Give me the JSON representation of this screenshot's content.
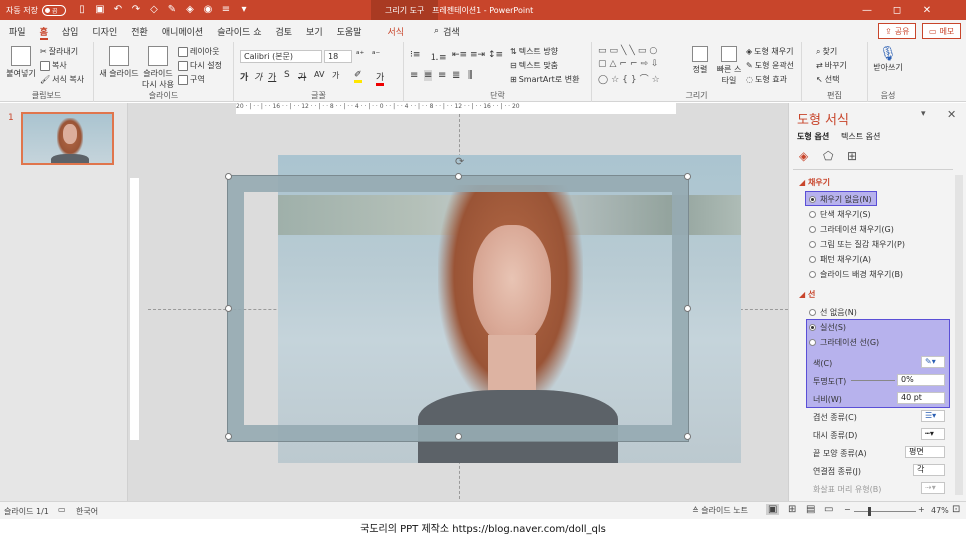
{
  "titlebar": {
    "autosave_label": "자동 저장",
    "autosave_state": "끔",
    "context_tab": "그리기 도구",
    "document_title": "프레젠테이션1 - PowerPoint",
    "win_min": "—",
    "win_restore": "◻",
    "win_close": "✕"
  },
  "menu": {
    "items": [
      "파일",
      "홈",
      "삽입",
      "디자인",
      "전환",
      "애니메이션",
      "슬라이드 쇼",
      "검토",
      "보기",
      "도움말"
    ],
    "context_item": "서식",
    "search": "검색",
    "share": "공유",
    "memo": "메모"
  },
  "ribbon": {
    "clipboard": {
      "paste": "붙여넣기",
      "cut": "잘라내기",
      "copy": "복사",
      "format_painter": "서식 복사",
      "label": "클립보드"
    },
    "slides": {
      "new_slide": "새 슬라이드",
      "reuse": "슬라이드 다시 사용",
      "layout": "레이아웃",
      "reset": "다시 설정",
      "section": "구역",
      "label": "슬라이드"
    },
    "font": {
      "name": "Calibri (본문)",
      "size": "18",
      "label": "글꼴"
    },
    "paragraph": {
      "text_direction": "텍스트 방향",
      "align_text": "텍스트 맞춤",
      "smartart": "SmartArt로 변환",
      "label": "단락"
    },
    "drawing": {
      "arrange": "정렬",
      "quick_styles": "빠른 스타일",
      "fill": "도형 채우기",
      "outline": "도형 윤곽선",
      "effects": "도형 효과",
      "label": "그리기"
    },
    "editing": {
      "find": "찾기",
      "replace": "바꾸기",
      "select": "선택",
      "label": "편집"
    },
    "voice": {
      "dictate": "받아쓰기",
      "label": "음성"
    }
  },
  "slide_panel": {
    "number": "1"
  },
  "pane": {
    "title": "도형 서식",
    "tab_shape": "도형 옵션",
    "tab_text": "텍스트 옵션",
    "fill_section": "채우기",
    "fill_options": [
      "채우기 없음(N)",
      "단색 채우기(S)",
      "그라데이션 채우기(G)",
      "그림 또는 질감 채우기(P)",
      "패턴 채우기(A)",
      "슬라이드 배경 채우기(B)"
    ],
    "line_section": "선",
    "line_options": [
      "선 없음(N)",
      "실선(S)",
      "그라데이션 선(G)"
    ],
    "color_label": "색(C)",
    "transparency_label": "투명도(T)",
    "transparency_value": "0%",
    "width_label": "너비(W)",
    "width_value": "40 pt",
    "compound_label": "겹선 종류(C)",
    "dash_label": "대시 종류(D)",
    "cap_label": "끝 모양 종류(A)",
    "cap_value": "평면",
    "join_label": "연결점 종류(J)",
    "join_value": "각",
    "arrow_label": "화살표 머리 유형(B)"
  },
  "status": {
    "slide": "슬라이드 1/1",
    "language": "한국어",
    "notes": "슬라이드 노트",
    "zoom": "47%"
  },
  "caption": "국도리의 PPT 제작소 https://blog.naver.com/doll_qls"
}
